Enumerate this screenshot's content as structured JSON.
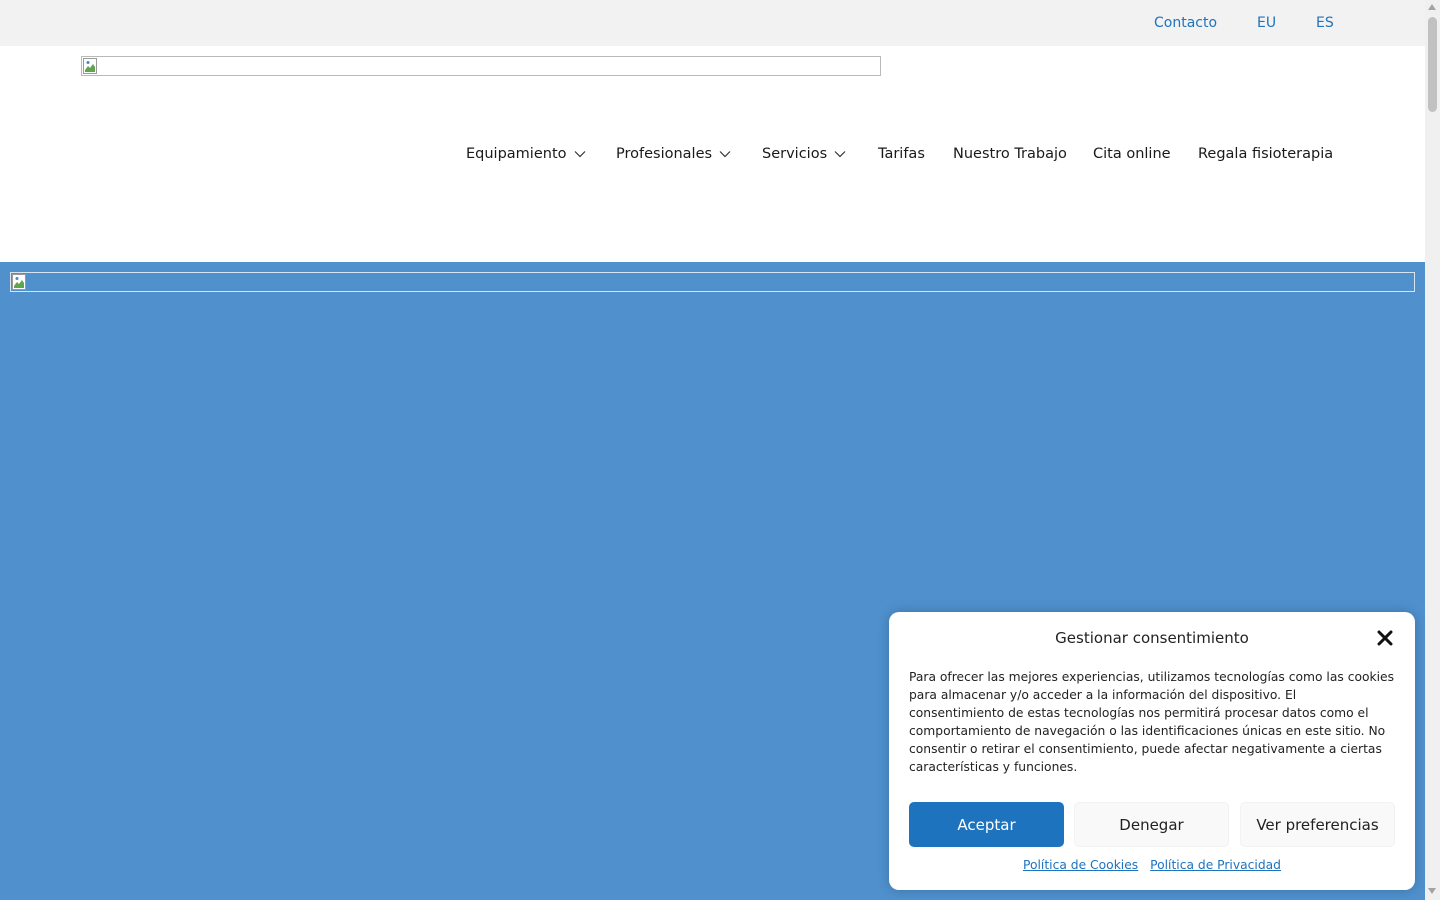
{
  "topbar": {
    "contact_label": "Contacto",
    "lang_eu": "EU",
    "lang_es": "ES"
  },
  "nav": {
    "items": [
      {
        "label": "Equipamiento",
        "has_dropdown": true
      },
      {
        "label": "Profesionales",
        "has_dropdown": true
      },
      {
        "label": "Servicios",
        "has_dropdown": true
      },
      {
        "label": "Tarifas",
        "has_dropdown": false
      },
      {
        "label": "Nuestro Trabajo",
        "has_dropdown": false
      },
      {
        "label": "Cita online",
        "has_dropdown": false
      },
      {
        "label": "Regala fisioterapia",
        "has_dropdown": false
      }
    ]
  },
  "icons": {
    "logo": "broken-image-icon",
    "hero": "broken-image-icon",
    "dropdown": "chevron-down-icon",
    "close": "close-icon"
  },
  "cookie_dialog": {
    "title": "Gestionar consentimiento",
    "body": "Para ofrecer las mejores experiencias, utilizamos tecnologías como las cookies para almacenar y/o acceder a la información del dispositivo. El consentimiento de estas tecnologías nos permitirá procesar datos como el comportamiento de navegación o las identificaciones únicas en este sitio. No consentir o retirar el consentimiento, puede afectar negativamente a ciertas características y funciones.",
    "accept_label": "Aceptar",
    "deny_label": "Denegar",
    "prefs_label": "Ver preferencias",
    "cookie_policy_label": "Política de Cookies",
    "privacy_policy_label": "Política de Privacidad"
  },
  "colors": {
    "accent": "#1e73be",
    "hero_background": "#4f90cd",
    "topbar_background": "#f2f2f2"
  }
}
